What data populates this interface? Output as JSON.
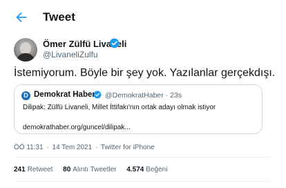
{
  "header": {
    "title": "Tweet"
  },
  "author": {
    "name": "Ömer Zülfü Livaneli",
    "handle": "@LivaneliZulfu"
  },
  "tweet": {
    "text": "İstemiyorum. Böyle bir şey yok. Yazılanlar gerçekdışı."
  },
  "quote": {
    "logo_letter": "D",
    "name": "Demokrat Haber",
    "handle": "@DemokratHaber · 23s",
    "text": "Dilipak: Zülfü Livaneli, Millet İttifakı'nın ortak adayı olmak istiyor",
    "link": "demokrathaber.org/guncel/dilipak..."
  },
  "meta": {
    "time": "ÖÖ 11:31",
    "date": "14 Tem 2021",
    "app": "Twitter for iPhone",
    "separator": "·"
  },
  "stats": {
    "retweets": {
      "count": "241",
      "label": "Retweet"
    },
    "quotes": {
      "count": "80",
      "label": "Alıntı Tweetler"
    },
    "likes": {
      "count": "4.574",
      "label": "Beğeni"
    }
  },
  "colors": {
    "accent": "#1d9bf0",
    "text": "#0f1419",
    "secondary": "#536471",
    "border": "#cfd9de"
  }
}
